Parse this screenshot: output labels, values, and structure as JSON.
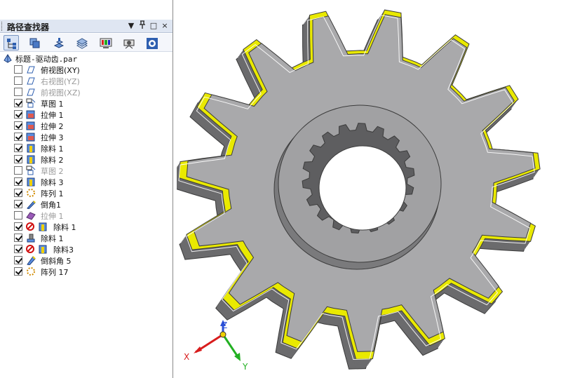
{
  "panel": {
    "title": "路径查找器",
    "controls": {
      "dropdown": "▼",
      "pin": "ᵠ",
      "restore": "□",
      "close": "×"
    },
    "toolbar": [
      "tree-view-icon",
      "layers-icon",
      "parts-icon",
      "sketch-planes-icon",
      "display-icon",
      "camera-icon",
      "settings-icon"
    ],
    "root_label": "标题-驱动齿.par",
    "items": [
      {
        "label": "俯视图(XY)",
        "checked": false,
        "icon": "plane-icon",
        "style": "selected"
      },
      {
        "label": "右视图(YZ)",
        "checked": false,
        "icon": "plane-icon",
        "style": "dim"
      },
      {
        "label": "前视图(XZ)",
        "checked": false,
        "icon": "plane-icon",
        "style": "dim"
      },
      {
        "label": "草图 1",
        "checked": true,
        "icon": "sketch-icon",
        "style": ""
      },
      {
        "label": "拉伸 1",
        "checked": true,
        "icon": "protrusion-icon",
        "style": ""
      },
      {
        "label": "拉伸 2",
        "checked": true,
        "icon": "protrusion-icon",
        "style": ""
      },
      {
        "label": "拉伸 3",
        "checked": true,
        "icon": "protrusion-icon",
        "style": ""
      },
      {
        "label": "除料 1",
        "checked": true,
        "icon": "cutout-icon",
        "style": ""
      },
      {
        "label": "除料 2",
        "checked": true,
        "icon": "cutout-icon",
        "style": ""
      },
      {
        "label": "草图 2",
        "checked": false,
        "icon": "sketch-icon",
        "style": "dim"
      },
      {
        "label": "除料 3",
        "checked": true,
        "icon": "cutout-icon",
        "style": ""
      },
      {
        "label": "阵列 1",
        "checked": true,
        "icon": "pattern-icon",
        "style": ""
      },
      {
        "label": "倒角1",
        "checked": true,
        "icon": "round-icon",
        "style": ""
      },
      {
        "label": "拉伸 1",
        "checked": false,
        "icon": "protrusion-purple-icon",
        "style": "dim"
      },
      {
        "label": "除料 1",
        "checked": true,
        "icon": "cutout-icon",
        "style": "",
        "warn": true
      },
      {
        "label": "除料 1",
        "checked": true,
        "icon": "cutout-small-icon",
        "style": ""
      },
      {
        "label": "除料3",
        "checked": true,
        "icon": "cutout-icon",
        "style": "",
        "warn": true
      },
      {
        "label": "倒斜角 5",
        "checked": true,
        "icon": "chamfer-icon",
        "style": ""
      },
      {
        "label": "阵列 17",
        "checked": true,
        "icon": "pattern-icon",
        "style": ""
      }
    ]
  },
  "viewport": {
    "triad": {
      "x": "X",
      "y": "Y",
      "z": "Z"
    },
    "gear": {
      "teeth": 15,
      "spline_teeth": 18,
      "colors": {
        "face": "#a9a9ab",
        "hub": "#a1a1a3",
        "side": "#6b6b6d",
        "chamfer": "#e9e900",
        "edge": "#3b3b3b",
        "curve": "#ffffff"
      }
    }
  }
}
